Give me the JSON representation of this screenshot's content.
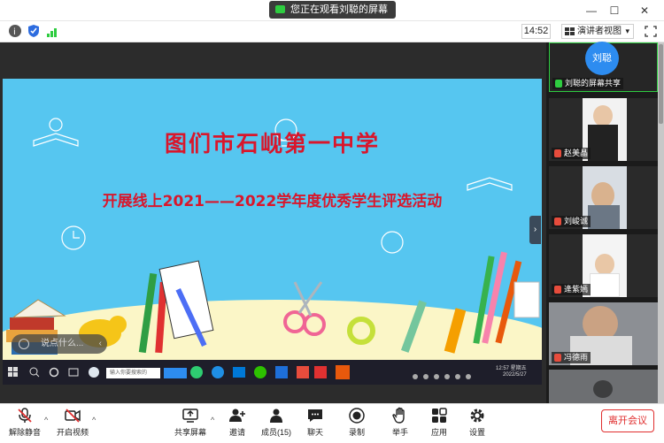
{
  "titlebar": {
    "share_status": "您正在观看刘聪的屏幕",
    "minimize": "—",
    "restore": "☐",
    "close": "✕"
  },
  "toolbar": {
    "clock": "14:52",
    "view_mode": "演讲者视图",
    "view_caret": "▾"
  },
  "slide": {
    "title": "图们市石岘第一中学",
    "subtitle": "开展线上2021——2022学年度优秀学生评选活动"
  },
  "remote_taskbar": {
    "search_placeholder": "输入你要搜索的",
    "time": "12:57 星期五",
    "date": "2022/5/27"
  },
  "chat_input": {
    "placeholder": "说点什么...",
    "chevron": "‹"
  },
  "participants": [
    {
      "name": "刘聪的屏幕共享",
      "avatar_text": "刘聪"
    },
    {
      "name": "赵美晶"
    },
    {
      "name": "刘峻诚"
    },
    {
      "name": "逄紫嫣"
    },
    {
      "name": "冯德雨"
    },
    {
      "name": ""
    }
  ],
  "bottom": {
    "unmute": "解除静音",
    "start_video": "开启视频",
    "share_screen": "共享屏幕",
    "invite": "邀请",
    "members": "成员(15)",
    "chat": "聊天",
    "record": "录制",
    "raise_hand": "举手",
    "apps": "应用",
    "settings": "设置",
    "leave": "离开会议",
    "caret": "^"
  },
  "colors": {
    "accent_red": "#e02e2e",
    "slide_bg": "#56c6f0",
    "slide_title": "#d9162b",
    "share_green": "#2ecc40"
  }
}
